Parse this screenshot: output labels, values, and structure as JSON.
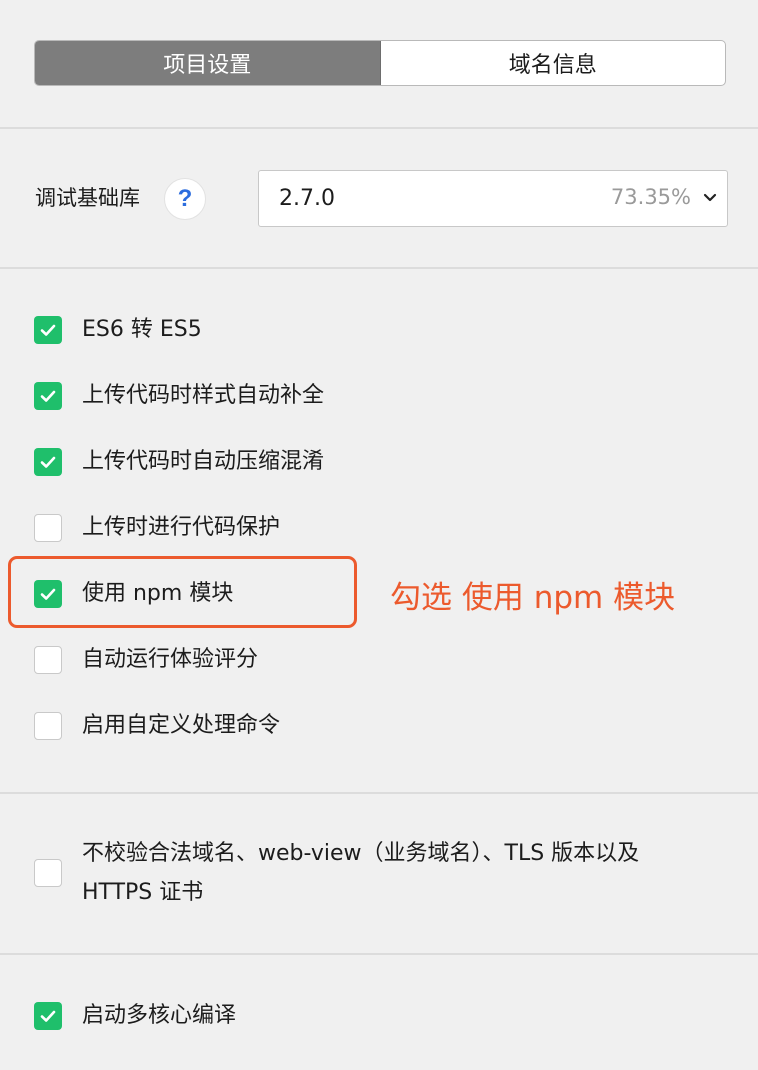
{
  "tabs": [
    {
      "label": "项目设置",
      "active": true
    },
    {
      "label": "域名信息",
      "active": false
    }
  ],
  "debug_lib": {
    "label": "调试基础库",
    "help_glyph": "?",
    "value": "2.7.0",
    "percent": "73.35%"
  },
  "options": [
    {
      "label": "ES6 转 ES5",
      "checked": true
    },
    {
      "label": "上传代码时样式自动补全",
      "checked": true
    },
    {
      "label": "上传代码时自动压缩混淆",
      "checked": true
    },
    {
      "label": "上传时进行代码保护",
      "checked": false
    },
    {
      "label": "使用 npm 模块",
      "checked": true
    },
    {
      "label": "自动运行体验评分",
      "checked": false
    },
    {
      "label": "启用自定义处理命令",
      "checked": false
    },
    {
      "label": "不校验合法域名、web-view（业务域名）、TLS 版本以及 HTTPS 证书",
      "checked": false
    },
    {
      "label": "启动多核心编译",
      "checked": true
    }
  ],
  "annotation": {
    "text": "勾选 使用 npm 模块",
    "color": "#ec5a2d"
  },
  "colors": {
    "check_green": "#1fbf6b",
    "active_tab": "#7d7d7d",
    "help_blue": "#2c6dde"
  }
}
